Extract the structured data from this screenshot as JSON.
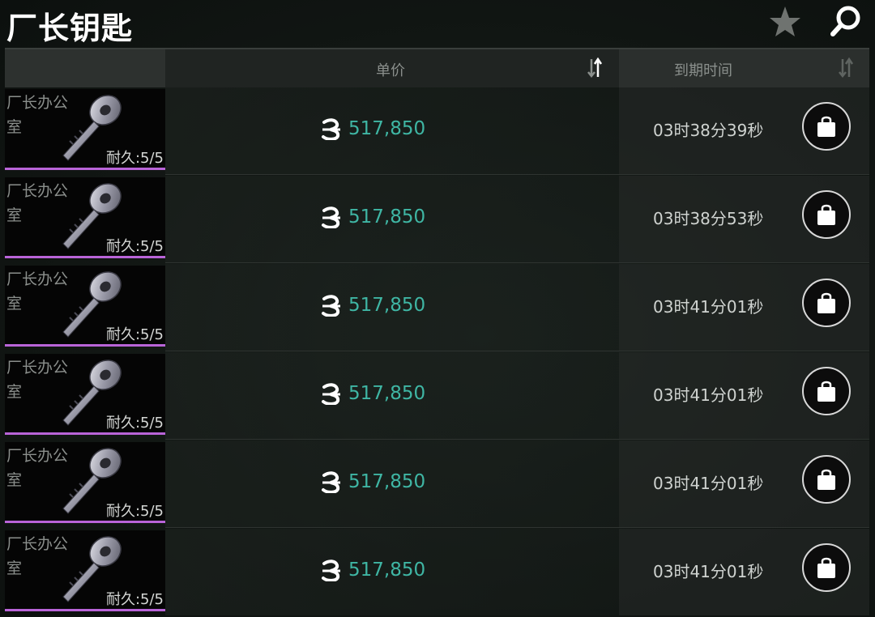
{
  "page": {
    "title": "厂长钥匙"
  },
  "header": {
    "item_col": "",
    "price_col": "单价",
    "time_col": "到期时间"
  },
  "icons": {
    "favorite": "star-icon",
    "search": "search-icon",
    "sort": "sort-arrows-icon",
    "currency": "coin-icon",
    "buy": "shopping-bag-icon",
    "item": "key-icon"
  },
  "colors": {
    "price": "#3fb6a4",
    "rarity_bar": "#b964d8"
  },
  "listings": [
    {
      "name": "厂长办公室",
      "durability": "耐久:5/5",
      "price": "517,850",
      "expires": "03时38分39秒"
    },
    {
      "name": "厂长办公室",
      "durability": "耐久:5/5",
      "price": "517,850",
      "expires": "03时38分53秒"
    },
    {
      "name": "厂长办公室",
      "durability": "耐久:5/5",
      "price": "517,850",
      "expires": "03时41分01秒"
    },
    {
      "name": "厂长办公室",
      "durability": "耐久:5/5",
      "price": "517,850",
      "expires": "03时41分01秒"
    },
    {
      "name": "厂长办公室",
      "durability": "耐久:5/5",
      "price": "517,850",
      "expires": "03时41分01秒"
    },
    {
      "name": "厂长办公室",
      "durability": "耐久:5/5",
      "price": "517,850",
      "expires": "03时41分01秒"
    }
  ]
}
